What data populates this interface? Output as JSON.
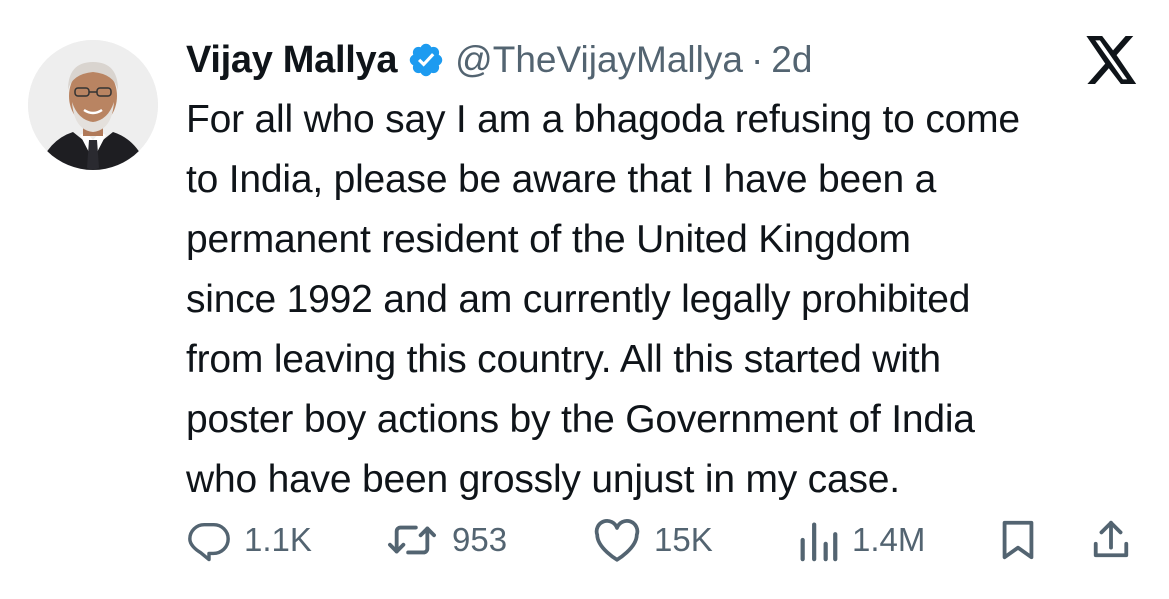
{
  "tweet": {
    "display_name": "Vijay Mallya",
    "handle": "@TheVijayMallya",
    "separator": "·",
    "time": "2d",
    "text": "For all who say I am a bhagoda refusing to come\nto India, please be aware that I have been a\npermanent resident of the United Kingdom\nsince 1992 and am currently legally prohibited\nfrom leaving this country. All this started with\nposter boy actions by the Government of India\nwho have been grossly unjust in my case."
  },
  "actions": {
    "replies": "1.1K",
    "reposts": "953",
    "likes": "15K",
    "views": "1.4M"
  },
  "icons": {
    "verified": "verified-badge-icon",
    "platform": "x-logo-icon",
    "reply": "reply-icon",
    "repost": "repost-icon",
    "like": "heart-icon",
    "views": "views-icon",
    "bookmark": "bookmark-icon",
    "share": "share-icon"
  },
  "colors": {
    "verified": "#1d9bf0",
    "text": "#0f1419",
    "secondary": "#536471"
  }
}
